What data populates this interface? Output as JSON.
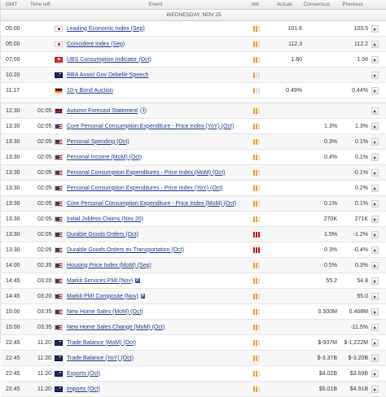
{
  "headers": {
    "gmt": "GMT",
    "time_left": "Time left",
    "event": "Event",
    "vol": "Vol.",
    "actual": "Actual",
    "consensus": "Consensus",
    "previous": "Previous"
  },
  "day_label": "WEDNESDAY, NOV 25",
  "colors": {
    "event_link": "#1a3c8c",
    "high_volatility": "#cc1111",
    "medium_volatility": "#f0a020"
  },
  "rows": [
    {
      "gmt": "05:00",
      "left": "",
      "flag": "jp",
      "event": "Leading Economic Index (Sep)",
      "vol": 2,
      "actual": "101.6",
      "consensus": "",
      "previous": "103.5"
    },
    {
      "gmt": "05:00",
      "left": "",
      "flag": "jp",
      "event": "Coincident Index (Sep)",
      "vol": 2,
      "actual": "112.3",
      "consensus": "",
      "previous": "112.2"
    },
    {
      "gmt": "07:00",
      "left": "",
      "flag": "ch",
      "event": "UBS Consumption Indicator (Oct)",
      "vol": 2,
      "actual": "1.60",
      "consensus": "",
      "previous": "1.56"
    },
    {
      "gmt": "10:20",
      "left": "",
      "flag": "au",
      "event": "RBA Assist Gov Debelle Speech",
      "vol": 1,
      "actual": "",
      "consensus": "",
      "previous": ""
    },
    {
      "gmt": "11:17",
      "left": "",
      "flag": "de",
      "event": "10-y Bond Auction",
      "vol": 1,
      "actual": "0.49%",
      "consensus": "",
      "previous": "0.44%"
    },
    {
      "gap": true
    },
    {
      "gmt": "12:30",
      "left": "01:05",
      "flag": "uk",
      "event": "Autumn Forecast Statement",
      "clock": true,
      "vol": 2,
      "actual": "",
      "consensus": "",
      "previous": ""
    },
    {
      "gmt": "13:30",
      "left": "02:05",
      "flag": "us",
      "event": "Core Personal Consumption Expenditure - Price Index (YoY) (Oct)",
      "vol": 2,
      "actual": "",
      "consensus": "1.3%",
      "previous": "1.3%"
    },
    {
      "gmt": "13:30",
      "left": "02:05",
      "flag": "us",
      "event": "Personal Spending (Oct)",
      "vol": 2,
      "actual": "",
      "consensus": "0.3%",
      "previous": "0.1%"
    },
    {
      "gmt": "13:30",
      "left": "02:05",
      "flag": "us",
      "event": "Personal Income (MoM) (Oct)",
      "vol": 2,
      "actual": "",
      "consensus": "0.4%",
      "previous": "0.1%"
    },
    {
      "gmt": "13:30",
      "left": "02:05",
      "flag": "us",
      "event": "Personal Consumption Expenditures - Price Index (MoM) (Oct)",
      "vol": 2,
      "actual": "",
      "consensus": "",
      "previous": "-0.1%"
    },
    {
      "gmt": "13:30",
      "left": "02:05",
      "flag": "us",
      "event": "Personal Consumption Expenditures - Price Index (YoY) (Oct)",
      "vol": 2,
      "actual": "",
      "consensus": "",
      "previous": "0.2%"
    },
    {
      "gmt": "13:30",
      "left": "02:05",
      "flag": "us",
      "event": "Core Personal Consumption Expenditure - Price Index (MoM) (Oct)",
      "vol": 2,
      "actual": "",
      "consensus": "0.1%",
      "previous": "0.1%"
    },
    {
      "gmt": "13:30",
      "left": "02:05",
      "flag": "us",
      "event": "Initial Jobless Claims (Nov 20)",
      "vol": 2,
      "actual": "",
      "consensus": "270K",
      "previous": "271K"
    },
    {
      "gmt": "13:30",
      "left": "02:05",
      "flag": "us",
      "event": "Durable Goods Orders (Oct)",
      "vol": 3,
      "actual": "",
      "consensus": "1.5%",
      "previous": "-1.2%"
    },
    {
      "gmt": "13:30",
      "left": "02:05",
      "flag": "us",
      "event": "Durable Goods Orders ex Transportation (Oct)",
      "vol": 3,
      "actual": "",
      "consensus": "0.3%",
      "previous": "-0.4%"
    },
    {
      "gmt": "14:00",
      "left": "02:35",
      "flag": "us",
      "event": "Housing Price Index (MoM) (Sep)",
      "vol": 2,
      "actual": "",
      "consensus": "0.5%",
      "previous": "0.3%"
    },
    {
      "gmt": "14:45",
      "left": "03:20",
      "flag": "us",
      "event": "Markit Services PMI (Nov)",
      "pre": "P",
      "vol": 2,
      "actual": "",
      "consensus": "55.2",
      "previous": "54.8"
    },
    {
      "gmt": "14:45",
      "left": "03:20",
      "flag": "us",
      "event": "Markit PMI Composite (Nov)",
      "pre": "P",
      "vol": 2,
      "actual": "",
      "consensus": "",
      "previous": "55.0"
    },
    {
      "gmt": "15:00",
      "left": "03:35",
      "flag": "us",
      "event": "New Home Sales (MoM) (Oct)",
      "vol": 2,
      "actual": "",
      "consensus": "0.500M",
      "previous": "0.468M"
    },
    {
      "gmt": "15:00",
      "left": "03:35",
      "flag": "us",
      "event": "New Home Sales Change (MoM) (Oct)",
      "vol": 2,
      "actual": "",
      "consensus": "",
      "previous": "-11.5%"
    },
    {
      "gmt": "22:45",
      "left": "11:20",
      "flag": "au",
      "event": "Trade Balance (MoM) (Oct)",
      "vol": 2,
      "actual": "",
      "consensus": "$-937M",
      "previous": "$-1,222M"
    },
    {
      "gmt": "22:45",
      "left": "11:20",
      "flag": "au",
      "event": "Trade Balance (YoY) (Oct)",
      "vol": 2,
      "actual": "",
      "consensus": "$-3.37B",
      "previous": "$-3.20B"
    },
    {
      "gmt": "22:45",
      "left": "11:20",
      "flag": "au",
      "event": "Exports (Oct)",
      "vol": 2,
      "actual": "",
      "consensus": "$4.02B",
      "previous": "$3.69B"
    },
    {
      "gmt": "22:45",
      "left": "11:20",
      "flag": "au",
      "event": "Imports (Oct)",
      "vol": 2,
      "actual": "",
      "consensus": "$5.01B",
      "previous": "$4.91B"
    }
  ]
}
